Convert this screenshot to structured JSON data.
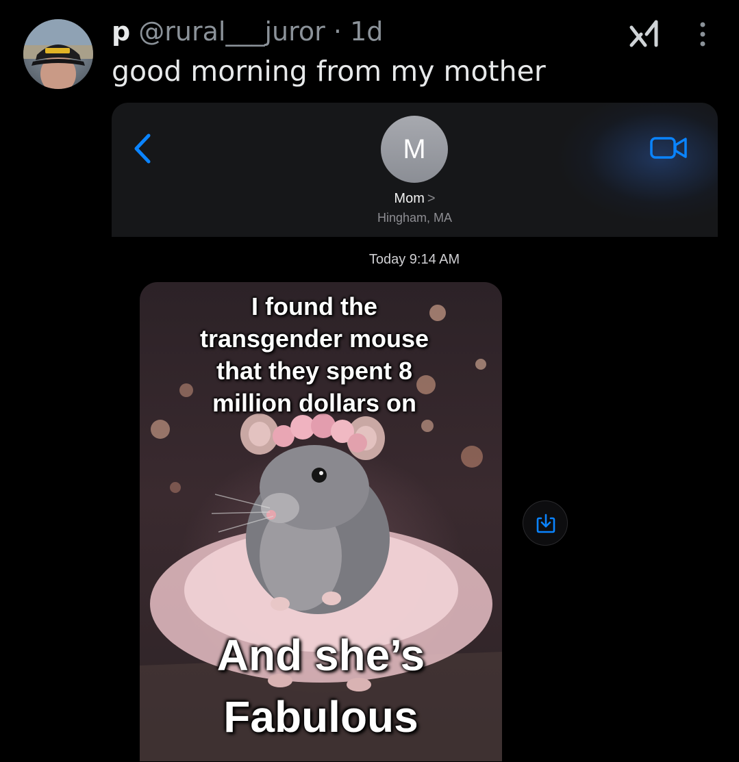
{
  "tweet": {
    "author_name": "p",
    "handle": "@rural___juror",
    "separator": "·",
    "age": "1d",
    "text": "good morning from my mother",
    "avatar": "profile-photo-icon",
    "grok_icon": "grok-icon",
    "more_icon": "more-options-icon"
  },
  "messages": {
    "back_icon": "chevron-left-icon",
    "contact_initial": "M",
    "contact_name": "Mom",
    "contact_chevron": ">",
    "contact_location": "Hingham, MA",
    "video_icon": "facetime-video-icon",
    "timestamp": "Today 9:14 AM",
    "save_icon": "share-save-icon"
  },
  "meme": {
    "top_text": "I found the\ntransgender mouse\nthat they spent 8\nmillion dollars on",
    "bottom_text": "And she’s\nFabulous"
  },
  "colors": {
    "background": "#000000",
    "ios_blue": "#0a84ff",
    "muted": "#8b9299"
  }
}
